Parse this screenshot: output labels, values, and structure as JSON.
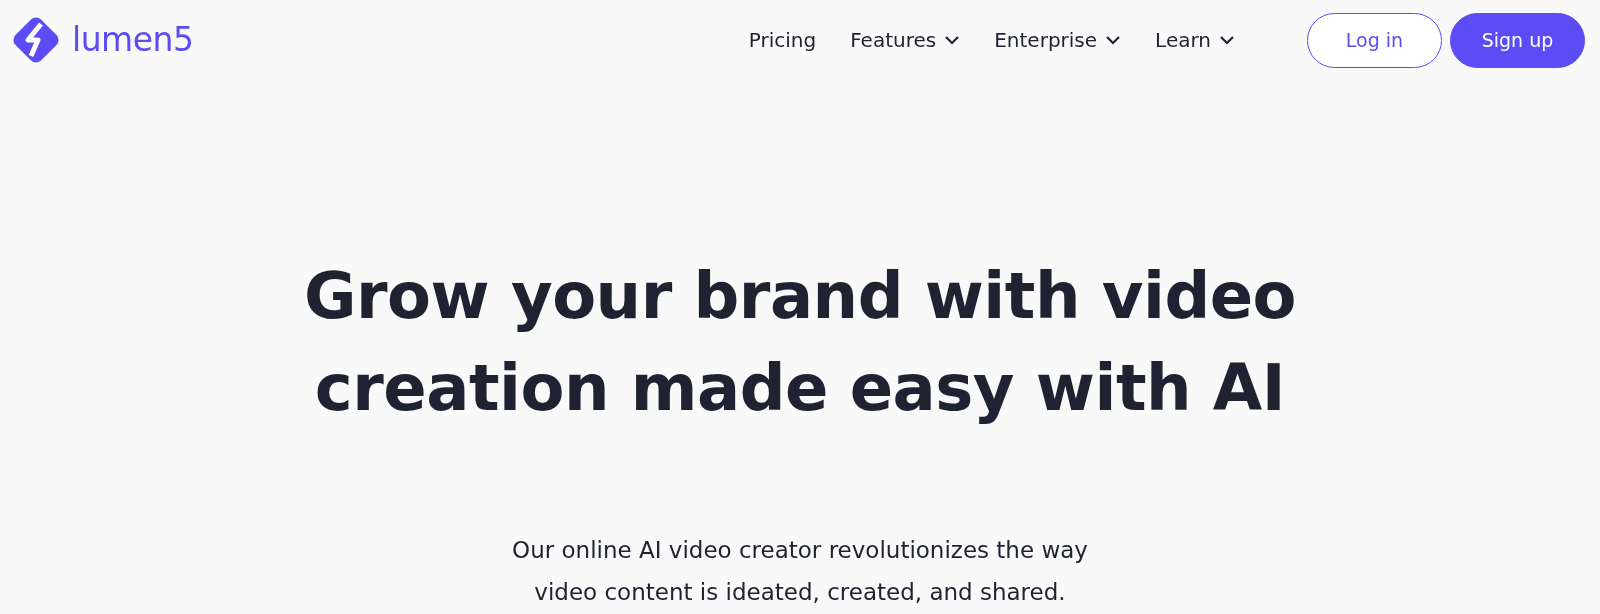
{
  "brand": {
    "name": "lumen5"
  },
  "nav": [
    {
      "label": "Pricing",
      "dropdown": false
    },
    {
      "label": "Features",
      "dropdown": true
    },
    {
      "label": "Enterprise",
      "dropdown": true
    },
    {
      "label": "Learn",
      "dropdown": true
    }
  ],
  "buttons": [
    {
      "label": "Log in",
      "kind": "outline"
    },
    {
      "label": "Sign up",
      "kind": "solid"
    }
  ],
  "hero": {
    "headline": [
      "Grow your brand with video",
      "creation made easy with AI"
    ],
    "subtitle": [
      "Our online AI video creator revolutionizes the way",
      "video content is ideated, created, and shared."
    ]
  }
}
